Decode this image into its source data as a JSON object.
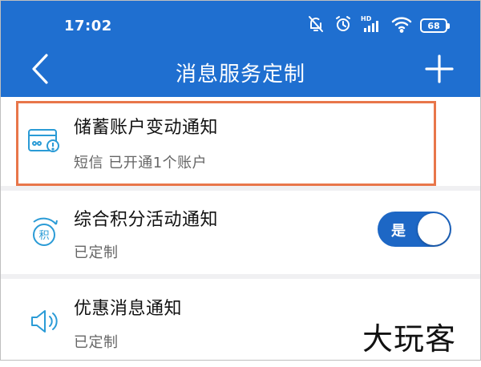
{
  "status_bar": {
    "time": "17:02",
    "battery": "68",
    "icons": [
      "mute-bell-icon",
      "alarm-clock-icon",
      "hd-signal-icon",
      "wifi-icon",
      "battery-icon"
    ]
  },
  "navbar": {
    "title": "消息服务定制",
    "back_icon": "chevron-left-icon",
    "add_icon": "plus-icon",
    "background": "#1f6fd0"
  },
  "items": [
    {
      "title": "储蓄账户变动通知",
      "subtitle": "短信  已开通1个账户",
      "icon": "card-alert-icon",
      "highlighted": true
    },
    {
      "title": "综合积分活动通知",
      "subtitle": "已定制",
      "icon": "points-icon",
      "toggle": {
        "label": "是",
        "on": true
      }
    },
    {
      "title": "优惠消息通知",
      "subtitle": "已定制",
      "icon": "speaker-icon"
    }
  ],
  "colors": {
    "accent": "#1f6fd0",
    "toggle_on": "#1d67c5",
    "icon_blue": "#2a9bd6",
    "highlight_border": "#e8764a"
  },
  "watermark": "大玩客"
}
